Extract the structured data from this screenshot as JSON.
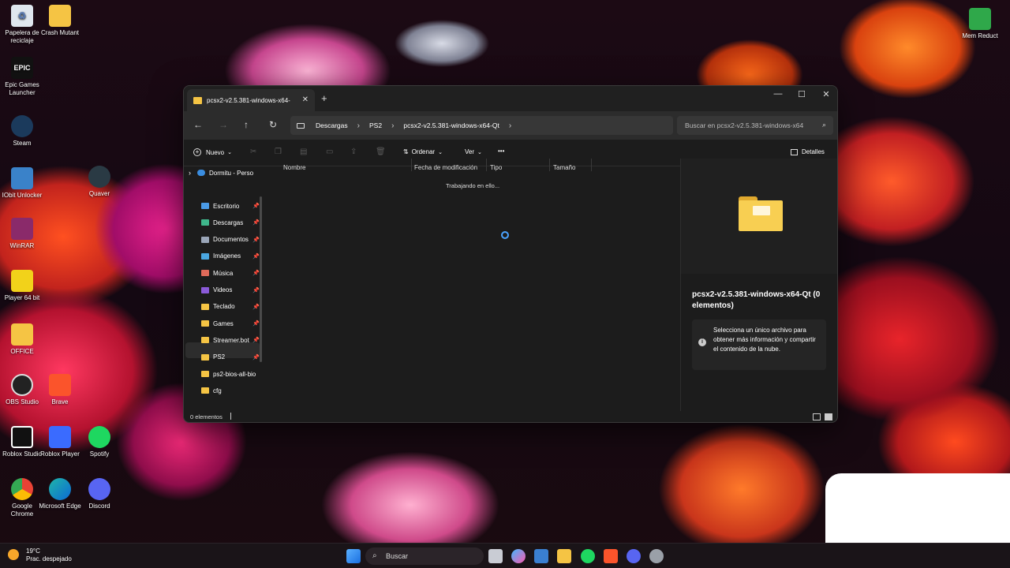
{
  "desktop": {
    "icons": [
      {
        "label": "Papelera de reciclaje"
      },
      {
        "label": "Crash Mutant"
      },
      {
        "label": "Epic Games Launcher"
      },
      {
        "label": "Steam"
      },
      {
        "label": "IObit Unlocker"
      },
      {
        "label": "Quaver"
      },
      {
        "label": "WinRAR"
      },
      {
        "label": "Player 64 bit"
      },
      {
        "label": "OFFICE"
      },
      {
        "label": "OBS Studio"
      },
      {
        "label": "Brave"
      },
      {
        "label": "Roblox Studio"
      },
      {
        "label": "Roblox Player"
      },
      {
        "label": "Spotify"
      },
      {
        "label": "Google Chrome"
      },
      {
        "label": "Microsoft Edge"
      },
      {
        "label": "Discord"
      },
      {
        "label": "Mem Reduct"
      }
    ],
    "epic_text": "EPIC"
  },
  "window": {
    "tab_title": "pcsx2-v2.5.381-windows-x64-",
    "tab_close": "✕",
    "new_tab": "+",
    "minimize": "—",
    "maximize": "☐",
    "close": "✕",
    "nav": {
      "back": "←",
      "forward": "→",
      "up": "↑",
      "refresh": "↻"
    },
    "breadcrumb": [
      "Descargas",
      "PS2",
      "pcsx2-v2.5.381-windows-x64-Qt"
    ],
    "search_placeholder": "Buscar en pcsx2-v2.5.381-windows-x64",
    "toolbar": {
      "new_label": "Nuevo",
      "sort_label": "Ordenar",
      "view_label": "Ver",
      "more": "•••",
      "details_label": "Detalles"
    },
    "sidebar": {
      "cloud": "Dormitu - Perso",
      "items": [
        {
          "label": "Escritorio",
          "color": "#4a9be8"
        },
        {
          "label": "Descargas",
          "color": "#3fb68b"
        },
        {
          "label": "Documentos",
          "color": "#9aa5b8"
        },
        {
          "label": "Imágenes",
          "color": "#4aa6e0"
        },
        {
          "label": "Música",
          "color": "#e06a5a"
        },
        {
          "label": "Videos",
          "color": "#8a5ad8"
        },
        {
          "label": "Teclado",
          "color": "#f5c444"
        },
        {
          "label": "Games",
          "color": "#f5c444"
        },
        {
          "label": "Streamer.bot",
          "color": "#f5c444"
        },
        {
          "label": "PS2",
          "color": "#f5c444"
        },
        {
          "label": "ps2-bios-all-bio",
          "color": "#f5c444"
        },
        {
          "label": "cfg",
          "color": "#f5c444"
        }
      ]
    },
    "columns": [
      "Nombre",
      "Fecha de modificación",
      "Tipo",
      "Tamaño"
    ],
    "working_text": "Trabajando en ello...",
    "details": {
      "title": "pcsx2-v2.5.381-windows-x64-Qt (0 elementos)",
      "info": "Selecciona un único archivo para obtener más información y compartir el contenido de la nube."
    },
    "status": "0 elementos"
  },
  "taskbar": {
    "temperature": "19°C",
    "weather": "Prac. despejado",
    "search_label": "Buscar"
  }
}
